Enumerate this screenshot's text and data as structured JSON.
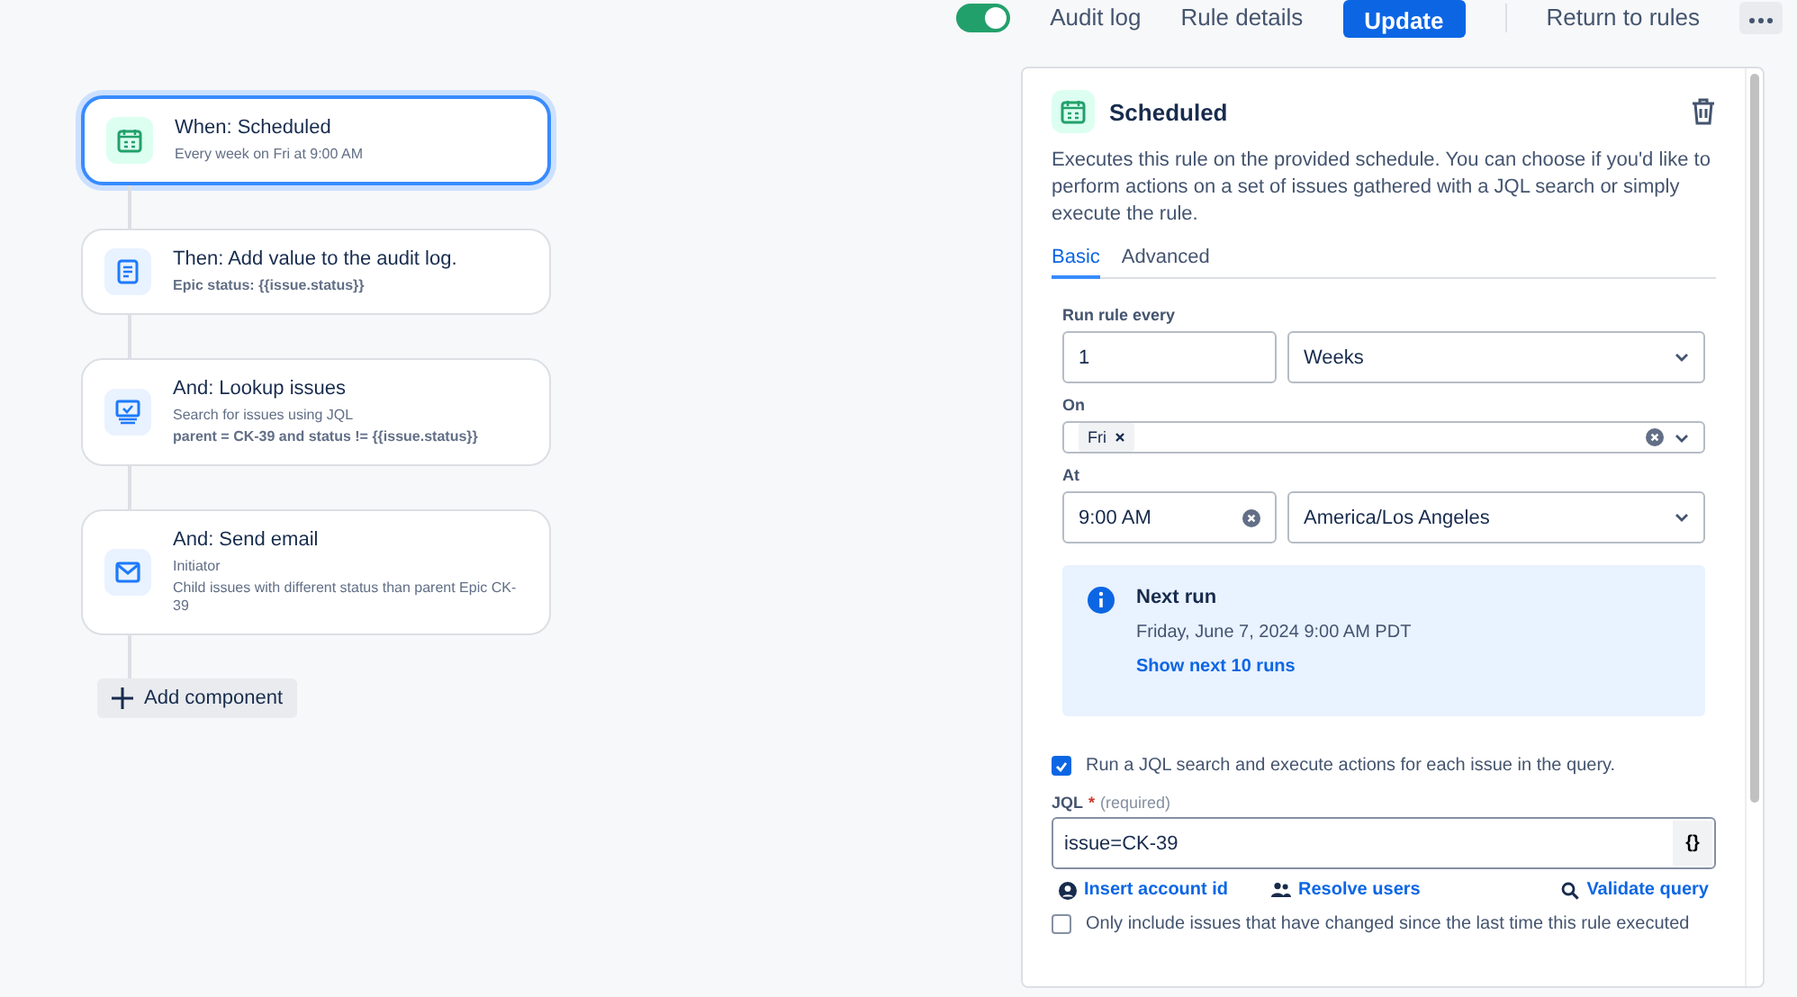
{
  "top_bar": {
    "rule_enabled": true,
    "links": [
      "Audit log",
      "Rule details"
    ],
    "update_button": "Update",
    "return_link": "Return to rules"
  },
  "canvas": {
    "components": [
      {
        "kind": "calendar",
        "title": "When: Scheduled",
        "selected": true,
        "details": [
          {
            "text": "Every week on Fri at 9:00 AM",
            "bold": false
          }
        ]
      },
      {
        "kind": "log",
        "title": "Then: Add value to the audit log.",
        "selected": false,
        "details": [
          {
            "text": "Epic status: {{issue.status}}",
            "bold": true
          }
        ]
      },
      {
        "kind": "lookup",
        "title": "And: Lookup issues",
        "selected": false,
        "details": [
          {
            "text": "Search for issues using JQL",
            "bold": false
          },
          {
            "text": "parent = CK-39 and status != {{issue.status}}",
            "bold": true
          }
        ]
      },
      {
        "kind": "email",
        "title": "And: Send email",
        "selected": false,
        "details": [
          {
            "text": "Initiator",
            "bold": false
          },
          {
            "text": "Child issues with different status than parent Epic CK-39",
            "bold": false
          }
        ]
      }
    ],
    "add_button": "Add component"
  },
  "panel": {
    "title": "Scheduled",
    "description": "Executes this rule on the provided schedule. You can choose if you'd like to perform actions on a set of issues gathered with a JQL search or simply execute the rule.",
    "tabs": [
      {
        "label": "Basic",
        "selected": true
      },
      {
        "label": "Advanced",
        "selected": false
      }
    ],
    "run_rule_every": {
      "label": "Run rule every",
      "value": "1",
      "unit": "Weeks"
    },
    "on": {
      "label": "On",
      "chips": [
        "Fri"
      ]
    },
    "at": {
      "label": "At",
      "time": "9:00 AM",
      "timezone": "America/Los Angeles"
    },
    "next_run": {
      "title": "Next run",
      "date": "Friday, June 7, 2024 9:00 AM PDT",
      "link": "Show next 10 runs"
    },
    "jql_search": {
      "label": "Run a JQL search and execute actions for each issue in the query.",
      "checked": true
    },
    "jql": {
      "label": "JQL",
      "required_mark": "*",
      "hint": "(required)",
      "value": "issue=CK-39",
      "format_button": "{}"
    },
    "links": [
      {
        "kind": "account",
        "label": "Insert account id"
      },
      {
        "kind": "users",
        "label": "Resolve users"
      },
      {
        "kind": "validate",
        "label": "Validate query"
      }
    ],
    "only_changed": {
      "label": "Only include issues that have changed since the last time this rule executed",
      "checked": false
    }
  }
}
